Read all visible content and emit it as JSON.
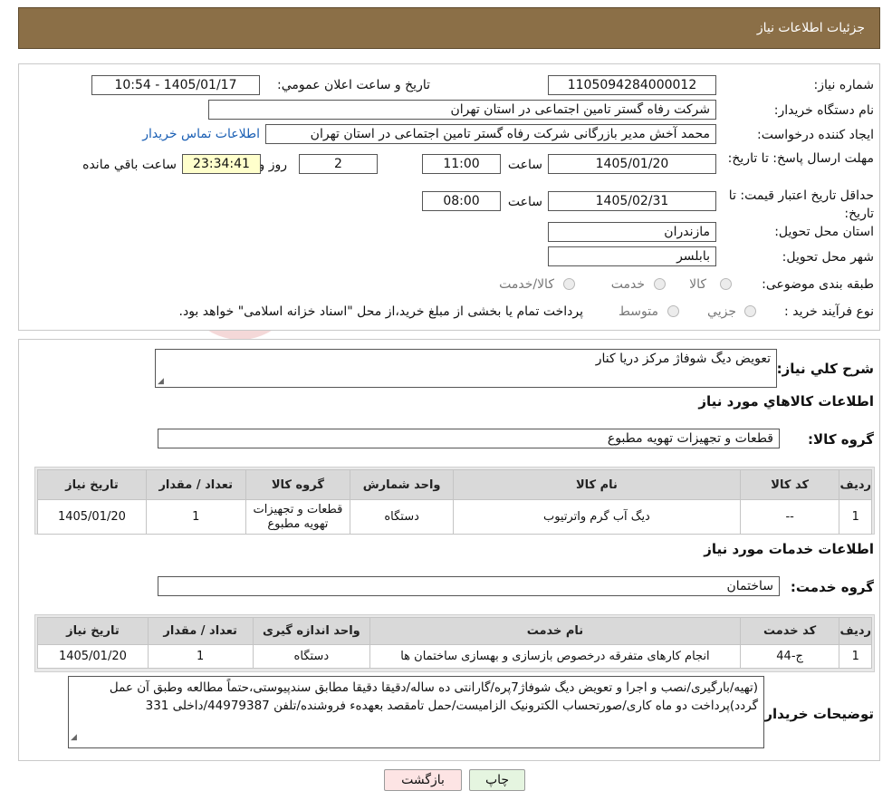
{
  "header": {
    "title": "جزئیات اطلاعات نیاز"
  },
  "form": {
    "need_number": {
      "label": "شماره نیاز:",
      "value": "1105094284000012"
    },
    "announce_datetime": {
      "label": "تاریخ و ساعت اعلان عمومي:",
      "value": "1405/01/17 - 10:54"
    },
    "buyer_org": {
      "label": "نام دستگاه خریدار:",
      "value": "شرکت رفاه گستر تامین اجتماعی در استان تهران"
    },
    "requester": {
      "label": "ایجاد کننده درخواست:",
      "value": "محمد آخش مدیر بازرگانی شرکت رفاه گستر تامین اجتماعی در استان تهران",
      "contact_link": "اطلاعات تماس خریدار"
    },
    "deadline": {
      "label": "مهلت ارسال پاسخ: تا تاریخ:",
      "date": "1405/01/20",
      "time_label": "ساعت",
      "time": "11:00",
      "days": "2",
      "days_label": "روز و",
      "remaining": "23:34:41",
      "remaining_label": "ساعت باقي مانده"
    },
    "validity": {
      "label": "حداقل تاریخ اعتبار قیمت: تا تاریخ:",
      "date": "1405/02/31",
      "time_label": "ساعت",
      "time": "08:00"
    },
    "province": {
      "label": "استان محل تحویل:",
      "value": "مازندران"
    },
    "city": {
      "label": "شهر محل تحویل:",
      "value": "بابلسر"
    },
    "category": {
      "label": "طبقه بندی موضوعی:",
      "options": [
        "کالا",
        "خدمت",
        "کالا/خدمت"
      ]
    },
    "process": {
      "label": "نوع فرآیند خرید :",
      "options": [
        "جزیي",
        "متوسط"
      ],
      "note": "پرداخت تمام یا بخشی از مبلغ خرید،از محل \"اسناد خزانه اسلامی\" خواهد بود."
    }
  },
  "summary": {
    "label": "شرح كلي نياز:",
    "value": "تعویض دیگ شوفاژ مرکز دریا کنار"
  },
  "goods": {
    "section_title": "اطلاعات كالاهاي مورد نياز",
    "group_label": "گروه کالا:",
    "group_value": "قطعات و تجهیزات تهویه مطبوع",
    "headers": [
      "ردیف",
      "کد کالا",
      "نام کالا",
      "واحد شمارش",
      "گروه کالا",
      "تعداد / مقدار",
      "تاریخ نیاز"
    ],
    "rows": [
      {
        "row": "1",
        "code": "--",
        "name": "دیگ آب گرم واترتیوب",
        "unit": "دستگاه",
        "group": "قطعات و تجهیزات تهویه مطبوع",
        "qty": "1",
        "date": "1405/01/20"
      }
    ]
  },
  "services": {
    "section_title": "اطلاعات خدمات مورد نياز",
    "group_label": "گروه خدمت:",
    "group_value": "ساختمان",
    "headers": [
      "ردیف",
      "کد خدمت",
      "نام خدمت",
      "واحد اندازه گیری",
      "تعداد / مقدار",
      "تاریخ نیاز"
    ],
    "rows": [
      {
        "row": "1",
        "code": "ج-44",
        "name": "انجام کارهای متفرقه درخصوص بازسازی و بهسازی ساختمان ها",
        "unit": "دستگاه",
        "qty": "1",
        "date": "1405/01/20"
      }
    ]
  },
  "buyer_notes": {
    "label": "توضیحات خریدار:",
    "value": "(تهیه/بارگیری/نصب و اجرا و تعویض دیگ شوفاژ7پره/گارانتی ده ساله/دقیقا دقیقا مطابق سندپیوستی،حتماً مطالعه وطبق آن عمل گردد)پرداخت دو ماه کاری/صورتحساب الکترونیک الزامیست/حمل تامقصد بعهدهء فروشنده/تلفن 44979387/داخلی 331"
  },
  "buttons": {
    "print": "چاپ",
    "back": "بازگشت"
  },
  "watermark": {
    "text": "AriaTender.neT"
  },
  "colors": {
    "header_bg": "#8b6f47",
    "link": "#1a5fb4",
    "remaining_bg": "#ffffcc",
    "back_btn_bg": "#fde4e4",
    "print_btn_bg": "#e5f5e0"
  }
}
